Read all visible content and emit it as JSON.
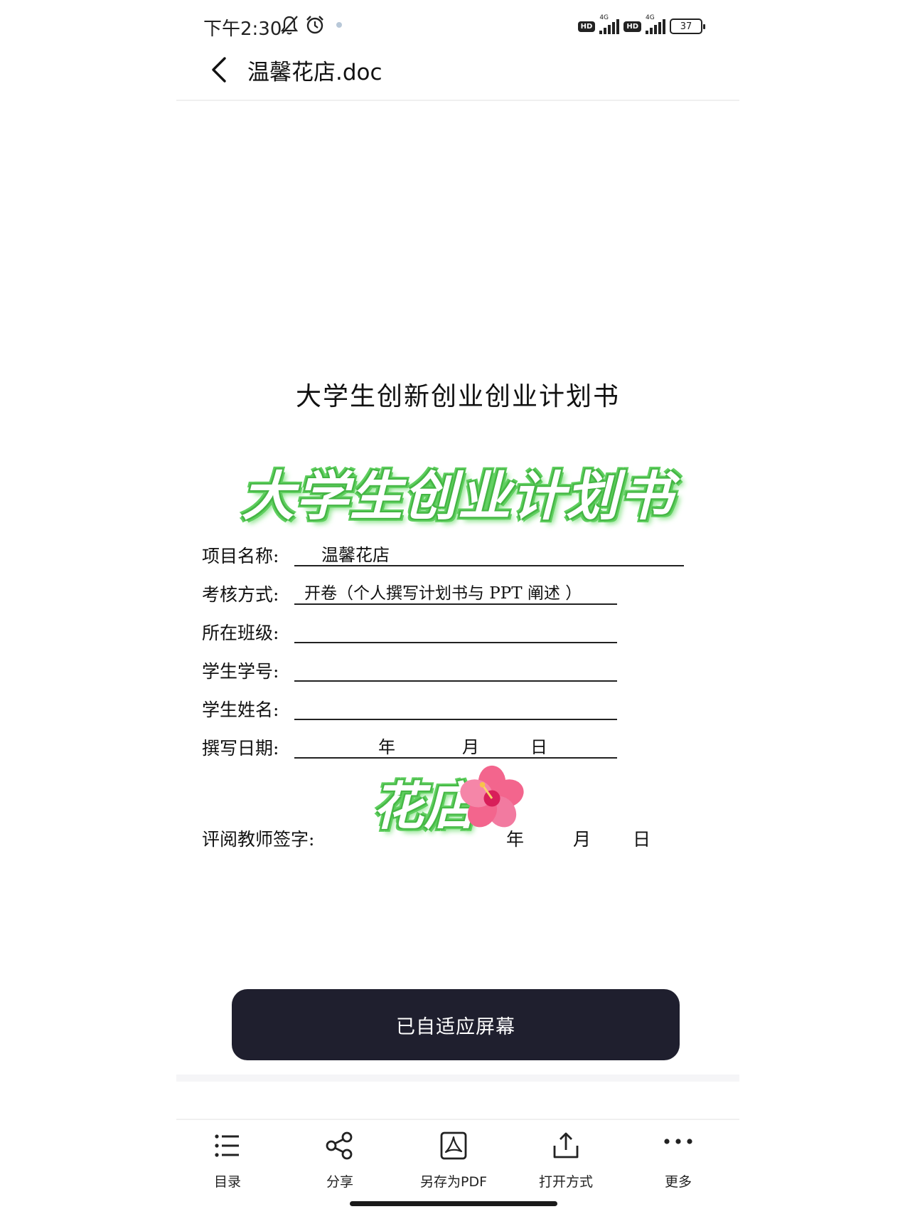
{
  "status_bar": {
    "time": "下午2:30",
    "hd_label": "HD",
    "network_label": "4G",
    "battery_level": "37"
  },
  "header": {
    "title": "温馨花店.doc"
  },
  "document": {
    "heading": "大学生创新创业创业计划书",
    "sticker_title": "大学生创业计划书",
    "fields": [
      {
        "label": "项目名称:",
        "value": "温馨花店"
      },
      {
        "label": "考核方式:",
        "value": "开卷（个人撰写计划书与 PPT 阐述 ）"
      },
      {
        "label": "所在班级:",
        "value": ""
      },
      {
        "label": "学生学号:",
        "value": ""
      },
      {
        "label": "学生姓名:",
        "value": ""
      },
      {
        "label": "撰写日期:",
        "value": ""
      }
    ],
    "date_parts": {
      "year": "年",
      "month": "月",
      "day": "日"
    },
    "sticker_shop": "花店",
    "teacher_sign_label": "评阅教师签字:",
    "colors": {
      "sticker_outline": "#46b846",
      "hibiscus": "#f0507a"
    }
  },
  "fit_button": {
    "label": "已自适应屏幕"
  },
  "toolbar": {
    "items": [
      {
        "label": "目录",
        "icon": "list-icon"
      },
      {
        "label": "分享",
        "icon": "share-icon"
      },
      {
        "label": "另存为PDF",
        "icon": "pdf-icon"
      },
      {
        "label": "打开方式",
        "icon": "upload-icon"
      },
      {
        "label": "更多",
        "icon": "more-icon"
      }
    ]
  }
}
